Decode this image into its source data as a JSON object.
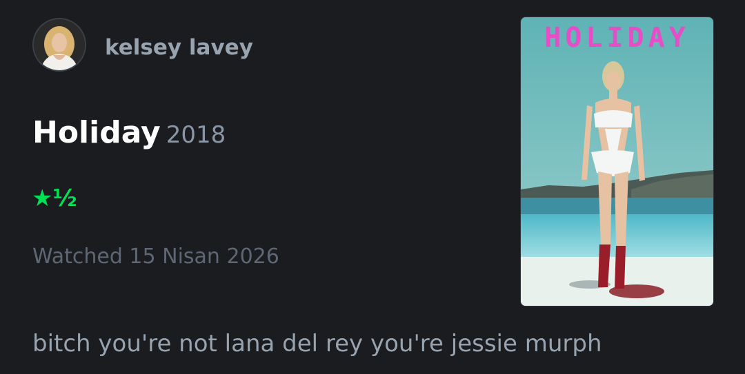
{
  "user": {
    "name": "kelsey lavey"
  },
  "film": {
    "title": "Holiday",
    "year": "2018"
  },
  "rating": {
    "display": "★½",
    "stars": 1.5,
    "max": 5,
    "color": "#00e054"
  },
  "watched": {
    "text": "Watched 15 Nisan 2026"
  },
  "review": {
    "text": "bitch you're not lana del rey you're jessie murph"
  },
  "poster": {
    "title": "HOLIDAY",
    "title_color": "#e64ec8"
  }
}
